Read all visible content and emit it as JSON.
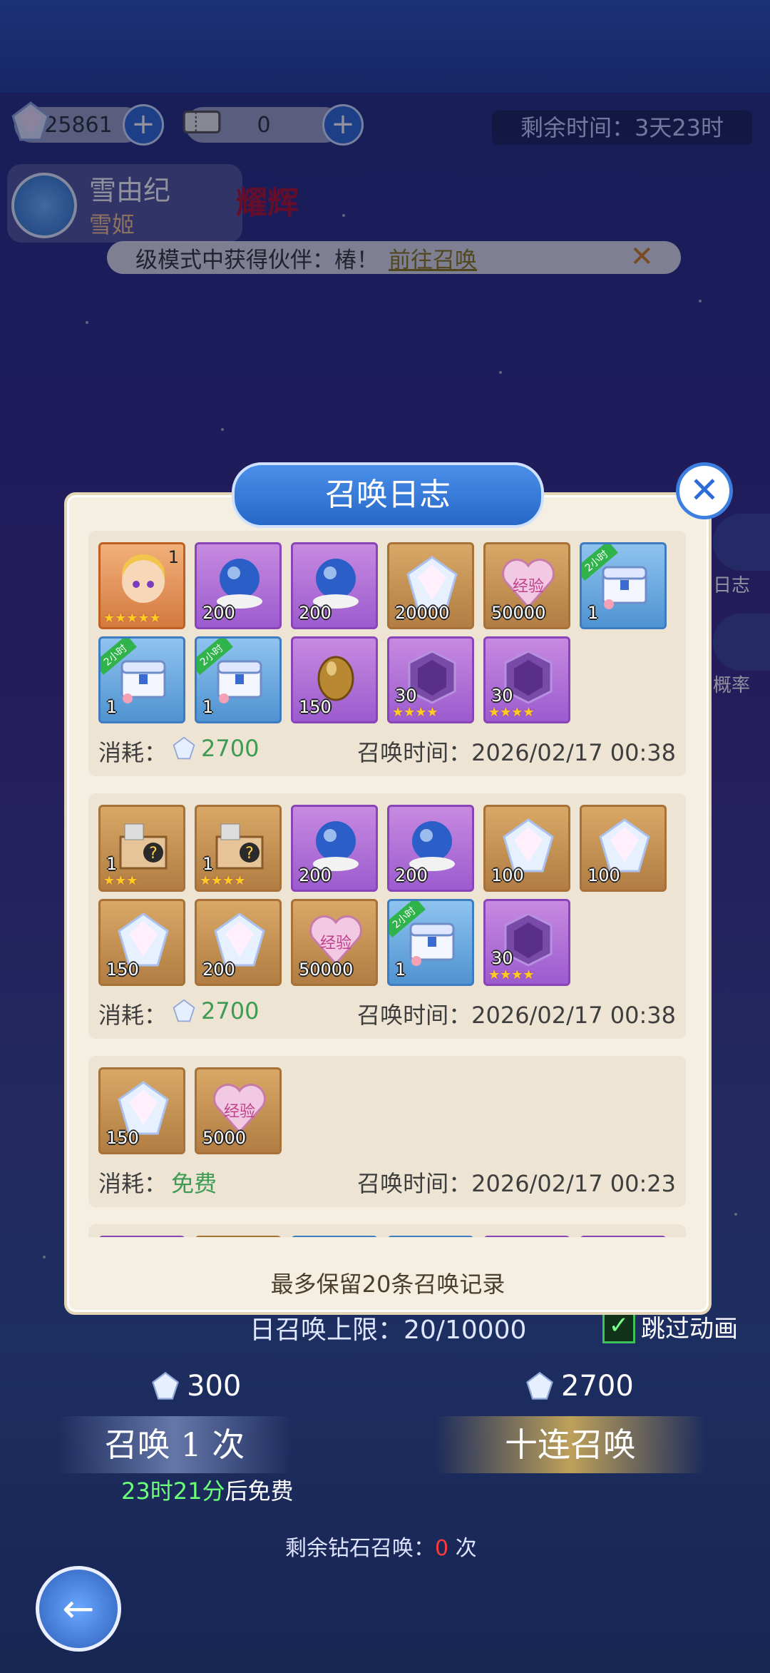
{
  "topbar": {
    "diamond_amount": "25861",
    "ticket_amount": "0",
    "remaining_time": "剩余时间：3天23时"
  },
  "character": {
    "name": "雪由纪",
    "subtitle": "雪姬",
    "badge": "耀辉"
  },
  "notice": {
    "text": "级模式中获得伙伴：",
    "partner": "椿！",
    "link": "前往召唤"
  },
  "side": {
    "log": "日志",
    "prob": "概率"
  },
  "dialog": {
    "title": "召唤日志",
    "footer": "最多保留20条召唤记录",
    "consume_label": "消耗：",
    "time_label": "召唤时间：",
    "records": [
      {
        "cost": "2700",
        "time": "2026/02/17 00:38",
        "items": [
          {
            "type": "character",
            "qty": "1",
            "stars": 5
          },
          {
            "type": "orb",
            "qty": "200"
          },
          {
            "type": "orb",
            "qty": "200"
          },
          {
            "type": "diamond",
            "qty": "20000"
          },
          {
            "type": "exp",
            "qty": "50000"
          },
          {
            "type": "chest",
            "qty": "1",
            "tag": "2小时"
          },
          {
            "type": "chest",
            "qty": "1",
            "tag": "2小时"
          },
          {
            "type": "chest",
            "qty": "1",
            "tag": "2小时"
          },
          {
            "type": "egg",
            "qty": "150"
          },
          {
            "type": "shard",
            "qty": "30",
            "stars": 4
          },
          {
            "type": "shard",
            "qty": "30",
            "stars": 4
          }
        ]
      },
      {
        "cost": "2700",
        "time": "2026/02/17 00:38",
        "items": [
          {
            "type": "box",
            "qty": "1",
            "stars": 3
          },
          {
            "type": "box",
            "qty": "1",
            "stars": 4
          },
          {
            "type": "orb",
            "qty": "200"
          },
          {
            "type": "orb",
            "qty": "200"
          },
          {
            "type": "diamond",
            "qty": "100"
          },
          {
            "type": "diamond",
            "qty": "100"
          },
          {
            "type": "diamond",
            "qty": "150"
          },
          {
            "type": "diamond",
            "qty": "200"
          },
          {
            "type": "exp",
            "qty": "50000"
          },
          {
            "type": "chest",
            "qty": "1",
            "tag": "2小时"
          },
          {
            "type": "shard",
            "qty": "30",
            "stars": 4
          }
        ]
      },
      {
        "cost": "免费",
        "time": "2026/02/17 00:23",
        "items": [
          {
            "type": "diamond",
            "qty": "150"
          },
          {
            "type": "exp",
            "qty": "5000"
          }
        ]
      },
      {
        "cost": "",
        "time": "",
        "items": [
          {
            "type": "orb",
            "qty": ""
          },
          {
            "type": "box",
            "qty": ""
          },
          {
            "type": "chest",
            "qty": "",
            "tag": "2小时"
          },
          {
            "type": "chest",
            "qty": "",
            "tag": "2小时"
          },
          {
            "type": "egg",
            "qty": ""
          },
          {
            "type": "egg",
            "qty": ""
          }
        ]
      }
    ]
  },
  "bottom": {
    "daily_limit": "日召唤上限：20/10000",
    "skip_animation": "跳过动画",
    "cost_single": "300",
    "cost_ten": "2700",
    "summon_one": "召唤 1 次",
    "summon_ten": "十连召唤",
    "free_after_time": "23时21分",
    "free_after_suffix": "后免费",
    "remain_diamond_label": "剩余钻石召唤：",
    "remain_diamond_value": "0",
    "remain_diamond_unit": "次"
  }
}
